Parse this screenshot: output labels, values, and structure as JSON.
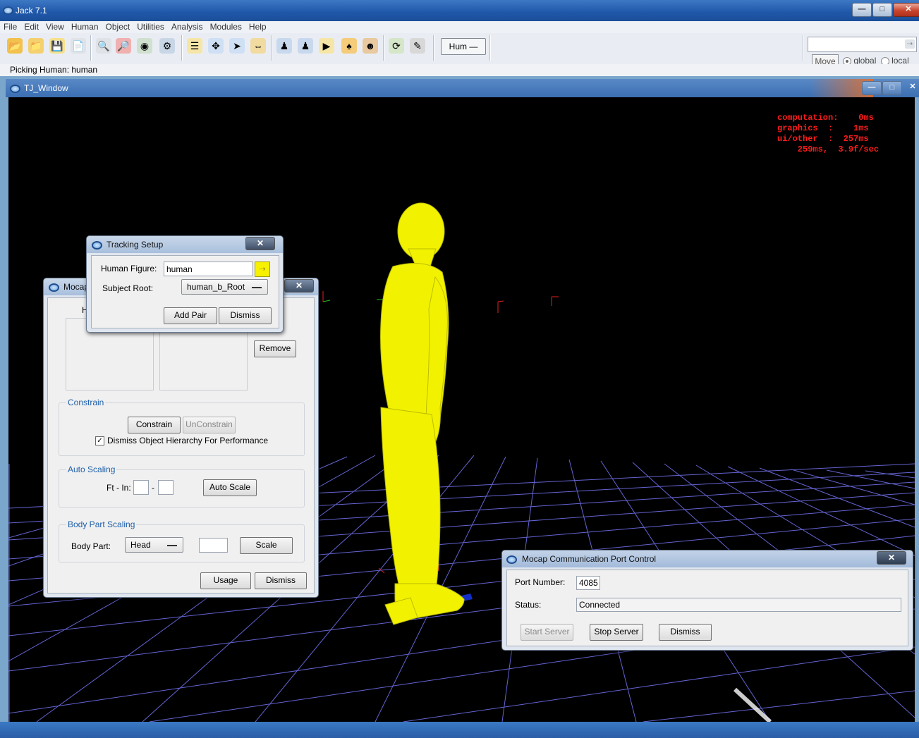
{
  "app": {
    "title": "Jack 7.1"
  },
  "menu": [
    "File",
    "Edit",
    "View",
    "Human",
    "Object",
    "Utilities",
    "Analysis",
    "Modules",
    "Help"
  ],
  "toolbar": {
    "human_select": "Hum",
    "move_label": "Move",
    "global_label": "global",
    "local_label": "local",
    "coord_mode": "global"
  },
  "status": {
    "text": "Picking Human: human"
  },
  "tj_window": {
    "title": "TJ_Window"
  },
  "perf": {
    "lines": [
      "computation:    0ms",
      "graphics  :    1ms",
      "ui/other  :  257ms",
      "    259ms,  3.9f/sec"
    ],
    "color": "#ff1b1b"
  },
  "figure": {
    "color": "#ffff00"
  },
  "mocap_dialog": {
    "title": "Mocap",
    "list_header": "H",
    "remove_label": "Remove",
    "constrain_group": "Constrain",
    "constrain_label": "Constrain",
    "unconstrain_label": "UnConstrain",
    "dismiss_hierarchy_label": "Dismiss Object Hierarchy For Performance",
    "dismiss_hierarchy_checked": true,
    "auto_scaling_group": "Auto Scaling",
    "ft_in_label": "Ft - In:",
    "ft_value": "",
    "dash": "-",
    "in_value": "",
    "auto_scale_label": "Auto Scale",
    "body_part_scaling_group": "Body Part Scaling",
    "body_part_label": "Body Part:",
    "body_part_value": "Head",
    "scale_value": "",
    "scale_label": "Scale",
    "usage_label": "Usage",
    "dismiss_label": "Dismiss"
  },
  "tracking_dialog": {
    "title": "Tracking Setup",
    "human_figure_label": "Human Figure:",
    "human_figure_value": "human",
    "subject_root_label": "Subject Root:",
    "subject_root_value": "human_b_Root",
    "add_pair_label": "Add Pair",
    "dismiss_label": "Dismiss"
  },
  "port_dialog": {
    "title": "Mocap Communication Port Control",
    "port_label": "Port Number:",
    "port_value": "4085",
    "status_label": "Status:",
    "status_value": "Connected",
    "start_label": "Start Server",
    "stop_label": "Stop Server",
    "dismiss_label": "Dismiss"
  }
}
